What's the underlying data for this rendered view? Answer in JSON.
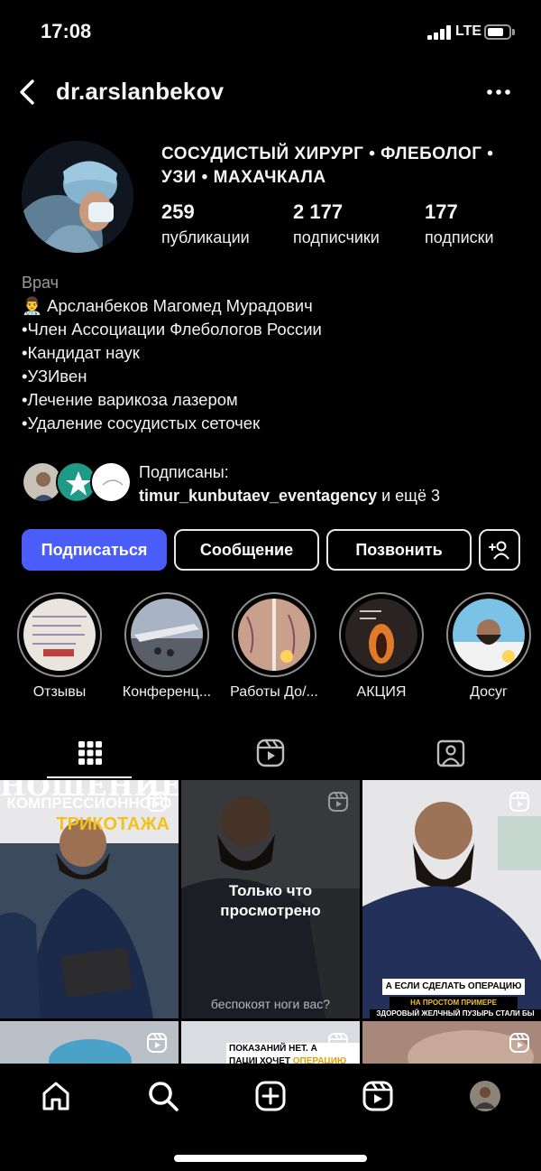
{
  "status": {
    "time": "17:08",
    "network": "LTE"
  },
  "header": {
    "username": "dr.arslanbekov"
  },
  "profile": {
    "category_title": "СОСУДИСТЫЙ ХИРУРГ • ФЛЕБОЛОГ • УЗИ • МАХАЧКАЛА",
    "stats": {
      "posts": {
        "value": "259",
        "label": "публикации"
      },
      "followers": {
        "value": "2 177",
        "label": "подписчики"
      },
      "following": {
        "value": "177",
        "label": "подписки"
      }
    },
    "bio": {
      "category": "Врач",
      "lines": [
        "👨‍⚕️ Арсланбеков Магомед Мурадович",
        "•Член Ассоциации Флебологов России",
        "•Кандидат наук",
        "•УЗИвен",
        "•Лечение варикоза лазером",
        "•Удаление сосудистых сеточек"
      ]
    },
    "followed_by": {
      "prefix": "Подписаны:",
      "account": "timur_kunbutaev_eventagency",
      "suffix": " и ещё 3"
    }
  },
  "actions": {
    "follow": "Подписаться",
    "message": "Сообщение",
    "call": "Позвонить"
  },
  "highlights": [
    {
      "label": "Отзывы"
    },
    {
      "label": "Конференц..."
    },
    {
      "label": "Работы До/..."
    },
    {
      "label": "АКЦИЯ"
    },
    {
      "label": "Досуг"
    }
  ],
  "grid": {
    "post1_lines": [
      "НОШЕНИЕ",
      "КОМПРЕССИОННОГО",
      "ТРИКОТАЖА"
    ],
    "post2_overlay": "Только что\nпросмотрено",
    "post2_caption": "беспокоят ноги вас?",
    "post3_question": "А ЕСЛИ СДЕЛАТЬ ОПЕРАЦИЮ ?",
    "post3_sub": "НА ПРОСТОМ ПРИМЕРЕ ОБЪЯСНЯЯ",
    "post3_small": "ЗДОРОВЫЙ ЖЕЛЧНЫЙ ПУЗЫРЬ СТАЛИ БЫ",
    "post5_line1": "ПОКАЗАНИЙ НЕТ. А ПАЦИЕН",
    "post5_line2a": "ХОЧЕТ ",
    "post5_line2b": "ОПЕРАЦИЮ"
  },
  "colors": {
    "accent": "#4a5df9",
    "background": "#000000",
    "secondary_text": "#9a9a9a"
  }
}
